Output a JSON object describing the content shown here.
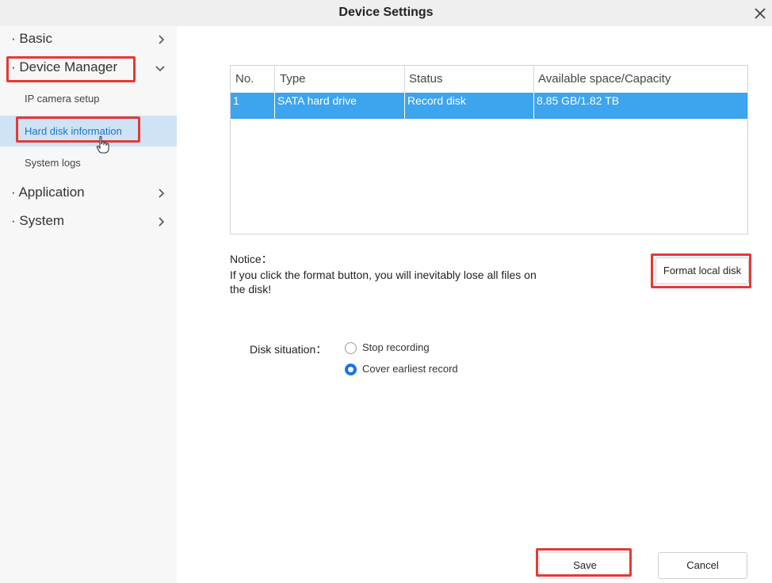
{
  "window": {
    "title": "Device Settings"
  },
  "sidebar": {
    "menus": [
      {
        "label": "· Basic"
      },
      {
        "label": "· Device Manager"
      },
      {
        "label": "· Application"
      },
      {
        "label": "· System"
      }
    ],
    "device_manager_items": [
      {
        "label": "IP camera setup"
      },
      {
        "label": "Hard disk information"
      },
      {
        "label": "System logs"
      }
    ]
  },
  "disk_table": {
    "columns": [
      "No.",
      "Type",
      "Status",
      "Available space/Capacity"
    ],
    "rows": [
      {
        "no": "1",
        "type": "SATA hard drive",
        "status": "Record disk",
        "capacity": "8.85 GB/1.82 TB"
      }
    ]
  },
  "notice": {
    "title": "Notice：",
    "text": "If you click the format button, you will inevitably lose all files on the disk!"
  },
  "format_button": {
    "label": "Format local disk"
  },
  "disk_situation": {
    "label": "Disk situation：",
    "options": [
      {
        "label": "Stop recording",
        "checked": false
      },
      {
        "label": "Cover earliest record",
        "checked": true
      }
    ]
  },
  "footer": {
    "save_label": "Save",
    "cancel_label": "Cancel"
  },
  "colors": {
    "accent": "#3da4ee",
    "highlight_red": "#e53935",
    "active_bg": "#cfe3f5",
    "radio_blue": "#1a73e8"
  }
}
